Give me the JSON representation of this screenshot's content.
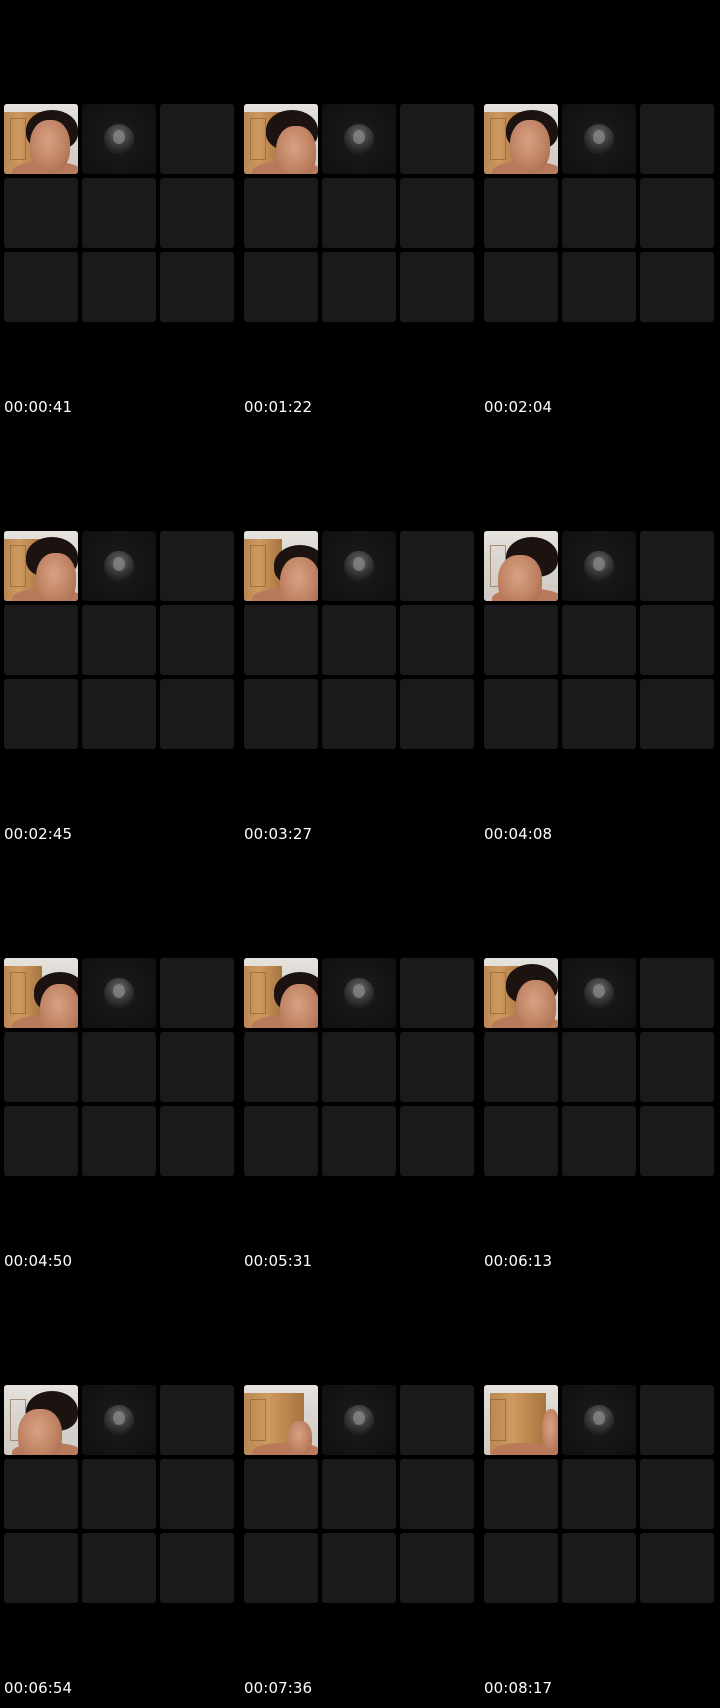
{
  "contact_sheet": {
    "background": "#000000",
    "tile_color": "#1a1a1a",
    "text_color": "#ffffff",
    "grid_rows": 3,
    "grid_cols": 3,
    "frames": [
      {
        "timestamp": "00:00:41",
        "camera_variant": "a"
      },
      {
        "timestamp": "00:01:22",
        "camera_variant": "b"
      },
      {
        "timestamp": "00:02:04",
        "camera_variant": "a"
      },
      {
        "timestamp": "00:02:45",
        "camera_variant": "b"
      },
      {
        "timestamp": "00:03:27",
        "camera_variant": "d"
      },
      {
        "timestamp": "00:04:08",
        "camera_variant": "c"
      },
      {
        "timestamp": "00:04:50",
        "camera_variant": "d"
      },
      {
        "timestamp": "00:05:31",
        "camera_variant": "d"
      },
      {
        "timestamp": "00:06:13",
        "camera_variant": "b"
      },
      {
        "timestamp": "00:06:54",
        "camera_variant": "c"
      },
      {
        "timestamp": "00:07:36",
        "camera_variant": "e"
      },
      {
        "timestamp": "00:08:17",
        "camera_variant": "f"
      }
    ]
  }
}
